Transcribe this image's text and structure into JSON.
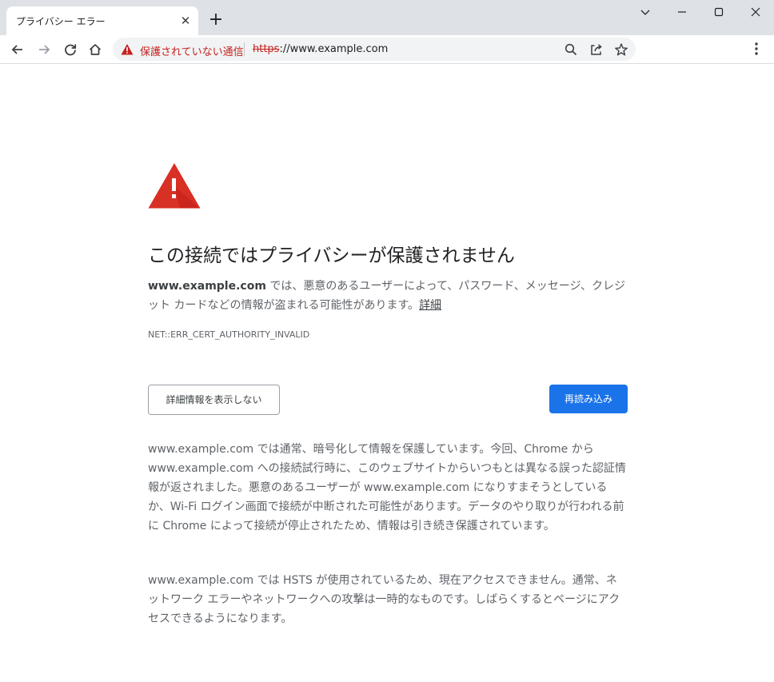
{
  "tab": {
    "title": "プライバシー エラー",
    "close_glyph": "✕",
    "new_tab_glyph": "+"
  },
  "window_controls": [
    "chevron-down",
    "minimize",
    "maximize",
    "close"
  ],
  "toolbar": {
    "security_label": "保護されていない通信",
    "url_scheme": "https",
    "url_rest": "://www.example.com"
  },
  "colors": {
    "danger": "#d93025",
    "insecure_text": "#c5221f",
    "primary_button": "#1a73e8",
    "body_text": "#5f6368"
  },
  "interstitial": {
    "heading": "この接続ではプライバシーが保護されません",
    "explanation_domain": "www.example.com",
    "explanation_text": " では、悪意のあるユーザーによって、パスワード、メッセージ、クレジット カードなどの情報が盗まれる可能性があります。",
    "learn_more": "詳細",
    "error_code": "NET::ERR_CERT_AUTHORITY_INVALID",
    "details_button": "詳細情報を表示しない",
    "reload_button": "再読み込み",
    "details_paragraph_1": "www.example.com では通常、暗号化して情報を保護しています。今回、Chrome から www.example.com への接続試行時に、このウェブサイトからいつもとは異なる誤った認証情報が返されました。悪意のあるユーザーが www.example.com になりすまそうとしているか、Wi-Fi ログイン画面で接続が中断された可能性があります。データのやり取りが行われる前に Chrome によって接続が停止されたため、情報は引き続き保護されています。",
    "details_paragraph_2": "www.example.com では HSTS が使用されているため、現在アクセスできません。通常、ネットワーク エラーやネットワークへの攻撃は一時的なものです。しばらくするとページにアクセスできるようになります。"
  },
  "icons": {
    "back": "back-arrow-icon",
    "forward": "forward-arrow-icon",
    "reload": "reload-icon",
    "home": "home-icon",
    "warning": "warning-triangle-icon",
    "search": "search-icon",
    "share": "share-icon",
    "bookmark": "star-icon",
    "menu": "kebab-menu-icon"
  }
}
